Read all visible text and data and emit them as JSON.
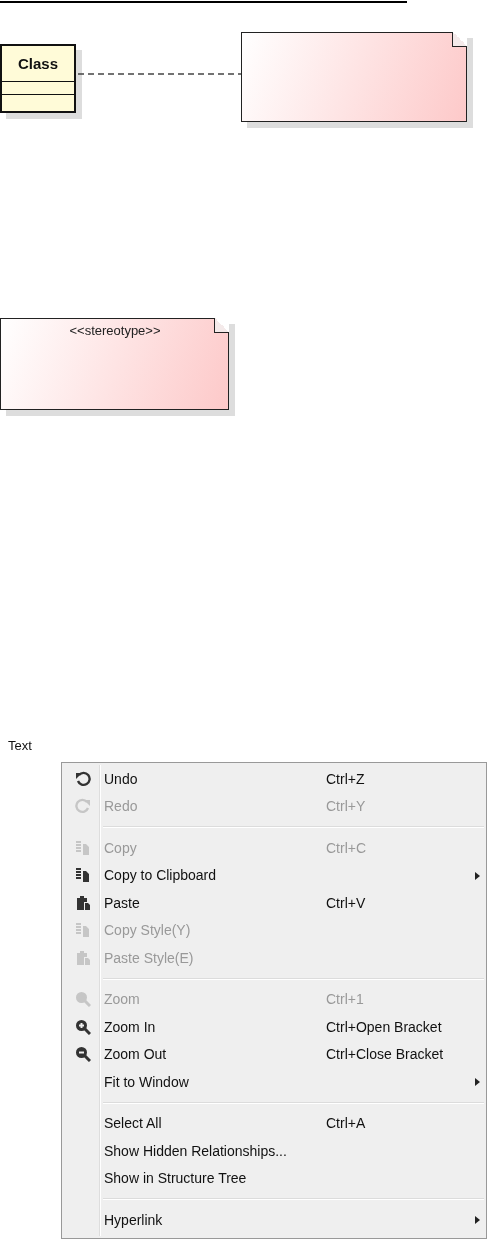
{
  "diagram": {
    "class": {
      "name": "Class"
    },
    "notes": [
      {
        "kind": "blank"
      },
      {
        "kind": "stereotype",
        "text": "<<stereotype>>"
      }
    ]
  },
  "context_menu": {
    "label": "Text",
    "items": [
      {
        "kind": "undo",
        "label": "Undo",
        "shortcut": "Ctrl+Z",
        "disabled": false,
        "submenu": false
      },
      {
        "kind": "redo",
        "label": "Redo",
        "shortcut": "Ctrl+Y",
        "disabled": true,
        "submenu": false
      },
      {
        "kind": "separator"
      },
      {
        "kind": "copy",
        "label": "Copy",
        "shortcut": "Ctrl+C",
        "disabled": true,
        "submenu": false
      },
      {
        "kind": "copy",
        "label": "Copy to Clipboard",
        "disabled": false,
        "submenu": true
      },
      {
        "kind": "paste",
        "label": "Paste",
        "shortcut": "Ctrl+V",
        "disabled": false,
        "submenu": false
      },
      {
        "kind": "copy",
        "label": "Copy Style(Y)",
        "disabled": true,
        "submenu": false
      },
      {
        "kind": "paste",
        "label": "Paste Style(E)",
        "disabled": true,
        "submenu": false
      },
      {
        "kind": "separator"
      },
      {
        "kind": "zoom",
        "label": "Zoom",
        "shortcut": "Ctrl+1",
        "disabled": true,
        "submenu": false
      },
      {
        "kind": "zoom-in",
        "label": "Zoom In",
        "shortcut": "Ctrl+Open Bracket",
        "disabled": false,
        "submenu": false
      },
      {
        "kind": "zoom-out",
        "label": "Zoom Out",
        "shortcut": "Ctrl+Close Bracket",
        "disabled": false,
        "submenu": false
      },
      {
        "kind": "plain",
        "label": "Fit to Window",
        "disabled": false,
        "submenu": true
      },
      {
        "kind": "separator"
      },
      {
        "kind": "plain",
        "label": "Select All",
        "shortcut": "Ctrl+A",
        "disabled": false,
        "submenu": false
      },
      {
        "kind": "plain",
        "label": "Show Hidden Relationships...",
        "disabled": false,
        "submenu": false
      },
      {
        "kind": "plain",
        "label": "Show in Structure Tree",
        "disabled": false,
        "submenu": false
      },
      {
        "kind": "separator"
      },
      {
        "kind": "plain",
        "label": "Hyperlink",
        "disabled": false,
        "submenu": true
      }
    ]
  }
}
